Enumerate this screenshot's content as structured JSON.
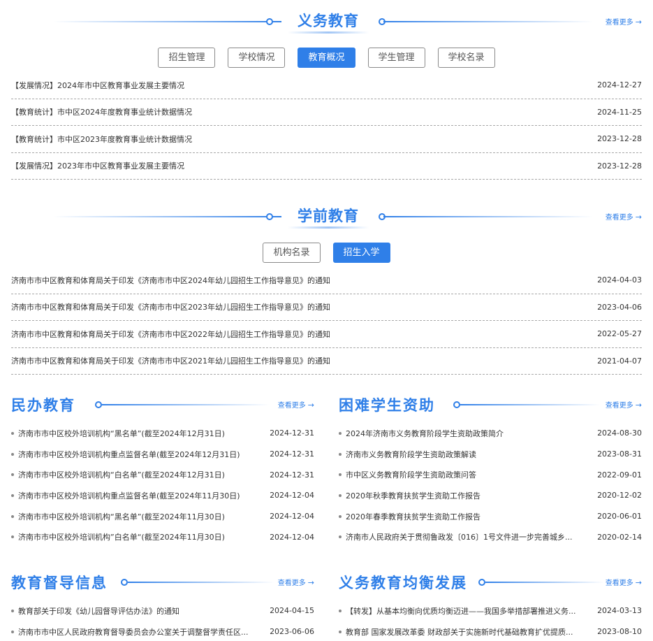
{
  "compulsory": {
    "title": "义务教育",
    "more": "查看更多",
    "tabs": [
      {
        "label": "招生管理",
        "active": false
      },
      {
        "label": "学校情况",
        "active": false
      },
      {
        "label": "教育概况",
        "active": true
      },
      {
        "label": "学生管理",
        "active": false
      },
      {
        "label": "学校名录",
        "active": false
      }
    ],
    "items": [
      {
        "title": "【发展情况】2024年市中区教育事业发展主要情况",
        "date": "2024-12-27"
      },
      {
        "title": "【教育统计】市中区2024年度教育事业统计数据情况",
        "date": "2024-11-25"
      },
      {
        "title": "【教育统计】市中区2023年度教育事业统计数据情况",
        "date": "2023-12-28"
      },
      {
        "title": "【发展情况】2023年市中区教育事业发展主要情况",
        "date": "2023-12-28"
      }
    ]
  },
  "preschool": {
    "title": "学前教育",
    "more": "查看更多",
    "tabs": [
      {
        "label": "机构名录",
        "active": false
      },
      {
        "label": "招生入学",
        "active": true
      }
    ],
    "items": [
      {
        "title": "济南市市中区教育和体育局关于印发《济南市市中区2024年幼儿园招生工作指导意见》的通知",
        "date": "2024-04-03"
      },
      {
        "title": "济南市市中区教育和体育局关于印发《济南市市中区2023年幼儿园招生工作指导意见》的通知",
        "date": "2023-04-06"
      },
      {
        "title": "济南市市中区教育和体育局关于印发《济南市市中区2022年幼儿园招生工作指导意见》的通知",
        "date": "2022-05-27"
      },
      {
        "title": "济南市市中区教育和体育局关于印发《济南市市中区2021年幼儿园招生工作指导意见》的通知",
        "date": "2021-04-07"
      }
    ]
  },
  "private_edu": {
    "title": "民办教育",
    "more": "查看更多",
    "items": [
      {
        "title": "济南市市中区校外培训机构“黑名单”(截至2024年12月31日)",
        "date": "2024-12-31"
      },
      {
        "title": "济南市市中区校外培训机构重点监督名单(截至2024年12月31日)",
        "date": "2024-12-31"
      },
      {
        "title": "济南市市中区校外培训机构“白名单”(截至2024年12月31日)",
        "date": "2024-12-31"
      },
      {
        "title": "济南市市中区校外培训机构重点监督名单(截至2024年11月30日)",
        "date": "2024-12-04"
      },
      {
        "title": "济南市市中区校外培训机构“黑名单”(截至2024年11月30日)",
        "date": "2024-12-04"
      },
      {
        "title": "济南市市中区校外培训机构”白名单“(截至2024年11月30日)",
        "date": "2024-12-04"
      }
    ]
  },
  "student_aid": {
    "title": "困难学生资助",
    "more": "查看更多",
    "items": [
      {
        "title": "2024年济南市义务教育阶段学生资助政策简介",
        "date": "2024-08-30"
      },
      {
        "title": "济南市义务教育阶段学生资助政策解读",
        "date": "2023-08-31"
      },
      {
        "title": "市中区义务教育阶段学生资助政策问答",
        "date": "2022-09-01"
      },
      {
        "title": "2020年秋季教育扶贫学生资助工作报告",
        "date": "2020-12-02"
      },
      {
        "title": "2020年春季教育扶贫学生资助工作报告",
        "date": "2020-06-01"
      },
      {
        "title": "济南市人民政府关于贯彻鲁政发〔016〕1号文件进一步完善城乡...",
        "date": "2020-02-14"
      }
    ]
  },
  "supervision": {
    "title": "教育督导信息",
    "more": "查看更多",
    "items": [
      {
        "title": "教育部关于印发《幼儿园督导评估办法》的通知",
        "date": "2024-04-15"
      },
      {
        "title": "济南市市中区人民政府教育督导委员会办公室关于调整督学责任区...",
        "date": "2023-06-06"
      }
    ]
  },
  "balanced": {
    "title": "义务教育均衡发展",
    "more": "查看更多",
    "items": [
      {
        "title": "【转发】从基本均衡向优质均衡迈进——我国多举措部署推进义务...",
        "date": "2024-03-13"
      },
      {
        "title": "教育部 国家发展改革委 财政部关于实施新时代基础教育扩优提质...",
        "date": "2023-08-10"
      }
    ]
  }
}
